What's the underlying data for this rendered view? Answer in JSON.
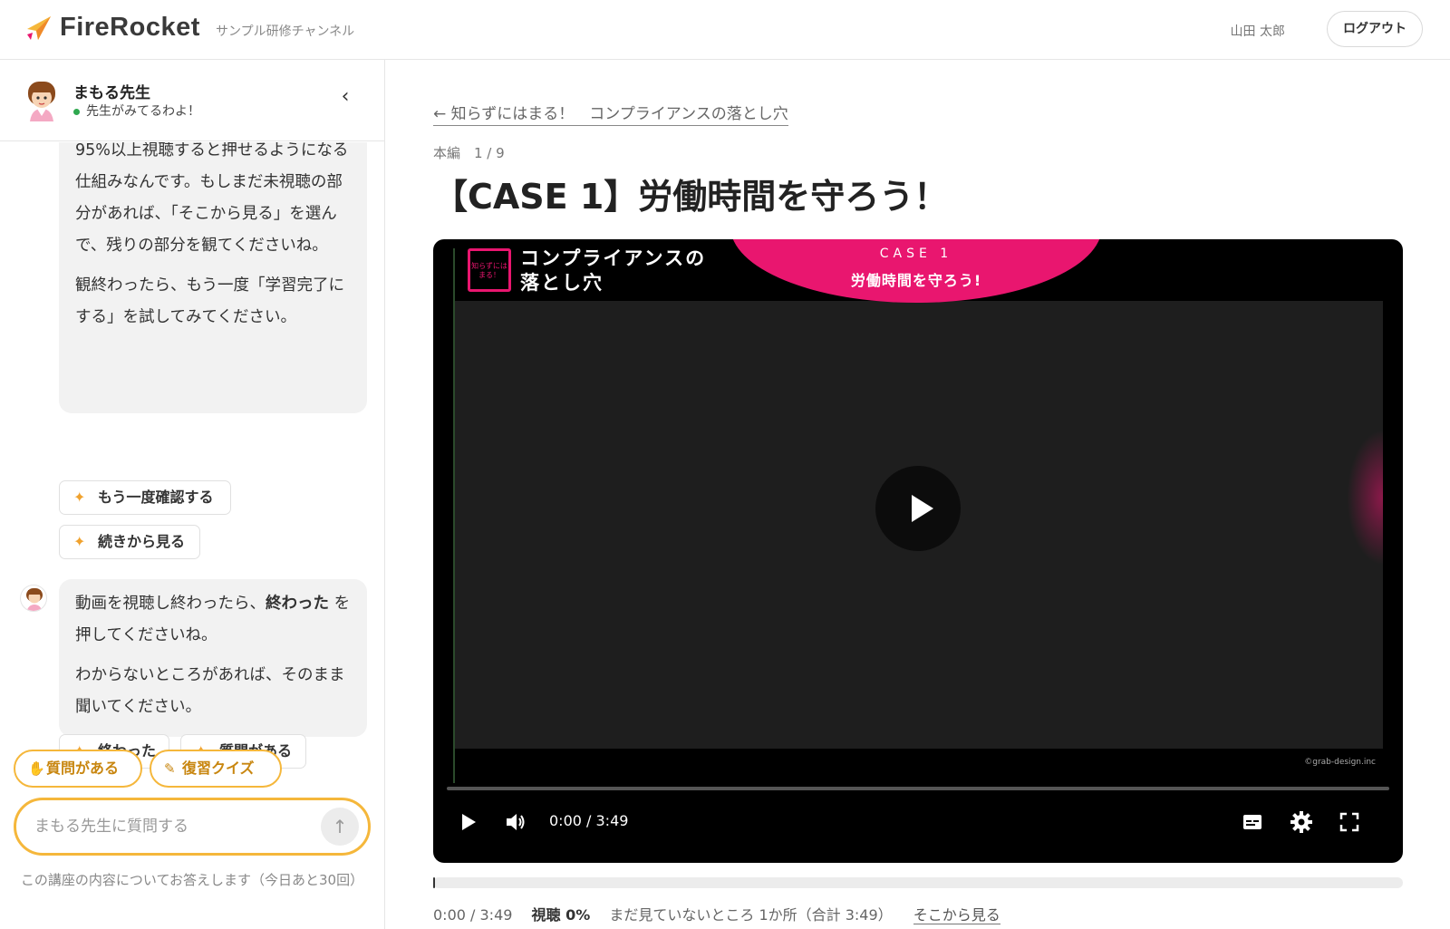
{
  "header": {
    "logo_text": "FireRocket",
    "channel": "サンプル研修チャンネル",
    "user_name": "山田 太郎",
    "logout_label": "ログアウト"
  },
  "sidebar": {
    "teacher_name": "まもる先生",
    "status": "先生がみてるわよ！",
    "messages": [
      {
        "paragraphs": [
          "95%以上視聴すると押せるようになる仕組みなんです。もしまだ未視聴の部分があれば、「そこから見る」を選んで、残りの部分を観てくださいね。",
          "観終わったら、もう一度「学習完了にする」を試してみてください。"
        ]
      },
      {
        "p1_before": "動画を視聴し終わったら、",
        "p1_bold": "終わった",
        "p1_after": " を押してくださいね。",
        "p2": "わからないところがあれば、そのまま聞いてください。"
      }
    ],
    "chips_1": [
      "もう一度確認する",
      "続きから見る"
    ],
    "chips_2": [
      "終わった",
      "質問がある"
    ],
    "pills": [
      {
        "icon": "raised-hand-icon",
        "label": "質問がある"
      },
      {
        "icon": "memo-icon",
        "label": "復習クイズ"
      }
    ],
    "input_placeholder": "まもる先生に質問する",
    "footnote": "この講座の内容についてお答えします（今日あと30回）"
  },
  "main": {
    "back_link": "← 知らずにはまる！　コンプライアンスの落とし穴",
    "section": "本編　1 / 9",
    "title": "【CASE 1】労働時間を守ろう！",
    "video": {
      "badge": "知らずにはまる！",
      "series_title_line1": "コンプライアンスの",
      "series_title_line2": "落とし穴",
      "case_label": "CASE 1",
      "case_subtitle": "労働時間を守ろう!",
      "copyright": "©grab-design.inc",
      "time": "0:00 / 3:49",
      "progress": 0
    },
    "info": {
      "time": "0:00 / 3:49",
      "watched": "視聴 0%",
      "unwatched": "まだ見ていないところ 1か所（合計 3:49）",
      "link": "そこから見る"
    }
  },
  "colors": {
    "accent": "#f5b73b",
    "brand_pink": "#e9166f",
    "status_green": "#2fa84f"
  }
}
